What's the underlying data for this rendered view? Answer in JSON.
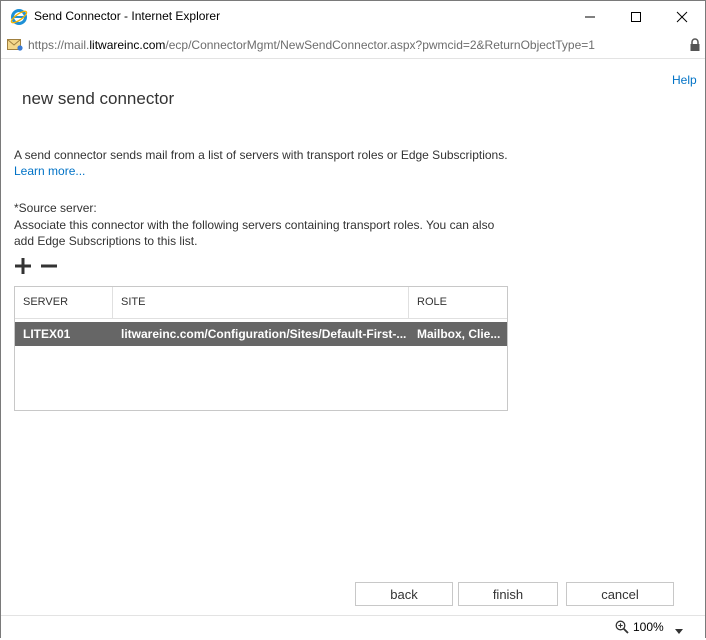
{
  "window": {
    "title": "Send Connector - Internet Explorer",
    "url_scheme": "https://mail.",
    "url_domain": "litwareinc.com",
    "url_path": "/ecp/ConnectorMgmt/NewSendConnector.aspx?pwmcid=2&ReturnObjectType=1"
  },
  "page": {
    "help_label": "Help",
    "title": "new send connector",
    "description": "A send connector sends mail from a list of servers with transport roles or Edge Subscriptions.",
    "learn_more": "Learn more...",
    "source_server_label": "*Source server:",
    "assoc_line1": "Associate this connector with the following servers containing transport roles. You can also",
    "assoc_line2": "add Edge Subscriptions to this list."
  },
  "table": {
    "columns": [
      "SERVER",
      "SITE",
      "ROLE"
    ],
    "rows": [
      {
        "server": "LITEX01",
        "site": "litwareinc.com/Configuration/Sites/Default-First-...",
        "role": "Mailbox, Clie..."
      }
    ]
  },
  "buttons": {
    "back": "back",
    "finish": "finish",
    "cancel": "cancel"
  },
  "status": {
    "zoom": "100%"
  },
  "icons": [
    "ie-logo-icon",
    "minimize-icon",
    "maximize-icon",
    "close-icon",
    "page-icon",
    "lock-icon",
    "add-icon",
    "remove-icon",
    "zoom-icon",
    "dropdown-arrow-icon"
  ],
  "colors": {
    "link": "#0072c6",
    "selected_row": "#666666"
  }
}
